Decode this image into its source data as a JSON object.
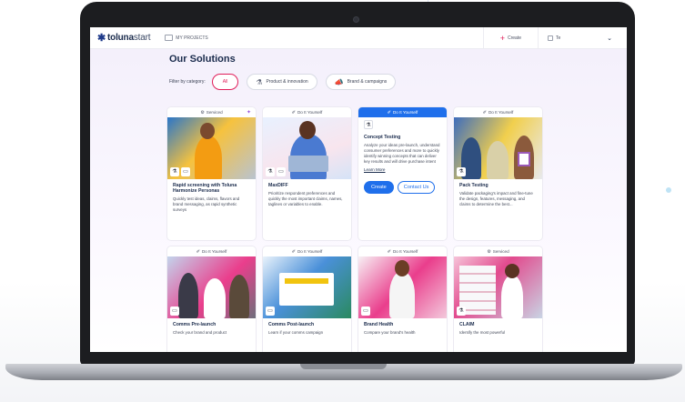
{
  "app": {
    "logo": {
      "prefix": "toluna",
      "suffix": "start"
    },
    "nav_projects": "MY PROJECTS",
    "create_label": "Create",
    "user_initials": "Te"
  },
  "page": {
    "title": "Our Solutions",
    "filter_label": "Filter by category:",
    "filters": [
      {
        "label": "All",
        "active": true
      },
      {
        "label": "Product & innovation",
        "icon": "flask-icon"
      },
      {
        "label": "Brand & campaigns",
        "icon": "megaphone-icon"
      }
    ]
  },
  "cards": [
    {
      "tag": "Serviced",
      "title": "Rapid screening with Toluna Harmonize Personas",
      "desc": "Quickly test ideas, claims, flavors and brand messaging, as rapid synthetic surveys"
    },
    {
      "tag": "Do It Yourself",
      "title": "MaxDIFF",
      "desc": "Prioritize respondent preferences and quickly the most important claims, names, taglines or variables to enable."
    },
    {
      "tag": "Do It Yourself",
      "selected": true,
      "title": "Concept Testing",
      "desc": "Analyze your ideas pre-launch, understand consumer preferences and more to quickly identify winning concepts that can deliver key results and will drive purchase intent",
      "learn_more": "Learn More",
      "create": "Create",
      "contact": "Contact Us"
    },
    {
      "tag": "Do It Yourself",
      "title": "Pack Testing",
      "desc": "Validate packaging's impact and fine-tune the design, features, messaging, and claims to determine the best..."
    },
    {
      "tag": "Do It Yourself",
      "title": "Comms Pre-launch",
      "desc": "Check your brand and product"
    },
    {
      "tag": "Do It Yourself",
      "title": "Comms Post-launch",
      "desc": "Learn if your comms campaign"
    },
    {
      "tag": "Do It Yourself",
      "title": "Brand Health",
      "desc": "Compare your brand's health"
    },
    {
      "tag": "Serviced",
      "title": "CLAIM",
      "desc": "Identify the most powerful"
    }
  ],
  "colors": {
    "brand": "#1a2b4c",
    "accent_pink": "#e01e5a",
    "accent_blue": "#1f6feb"
  }
}
